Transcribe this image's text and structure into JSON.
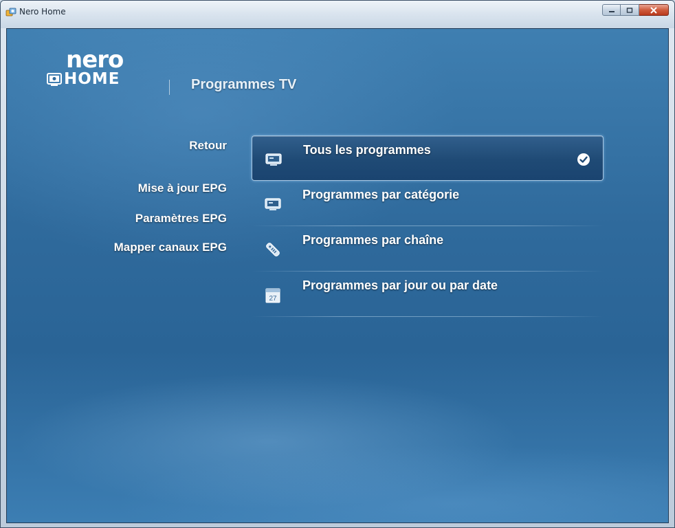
{
  "window": {
    "title": "Nero Home",
    "controls": {
      "minimize_icon": "minimize-icon",
      "maximize_icon": "maximize-icon",
      "close_icon": "close-icon"
    }
  },
  "logo": {
    "brand": "nero",
    "product": "HOME"
  },
  "page": {
    "title": "Programmes TV"
  },
  "side_menu": {
    "items": [
      {
        "label": "Retour"
      },
      {
        "label": "Mise à jour EPG"
      },
      {
        "label": "Paramètres EPG"
      },
      {
        "label": "Mapper canaux EPG"
      }
    ]
  },
  "menu": {
    "selected_index": 0,
    "items": [
      {
        "label": "Tous les programmes",
        "icon": "tv-icon",
        "selected": true
      },
      {
        "label": "Programmes par catégorie",
        "icon": "tv-icon",
        "selected": false
      },
      {
        "label": "Programmes par chaîne",
        "icon": "remote-icon",
        "selected": false
      },
      {
        "label": "Programmes par jour ou par date",
        "icon": "calendar-icon",
        "calendar_day": "27",
        "selected": false
      }
    ]
  },
  "colors": {
    "background": "#2f6a9c",
    "selected_item": "#1f4a75",
    "text": "#ffffff"
  }
}
